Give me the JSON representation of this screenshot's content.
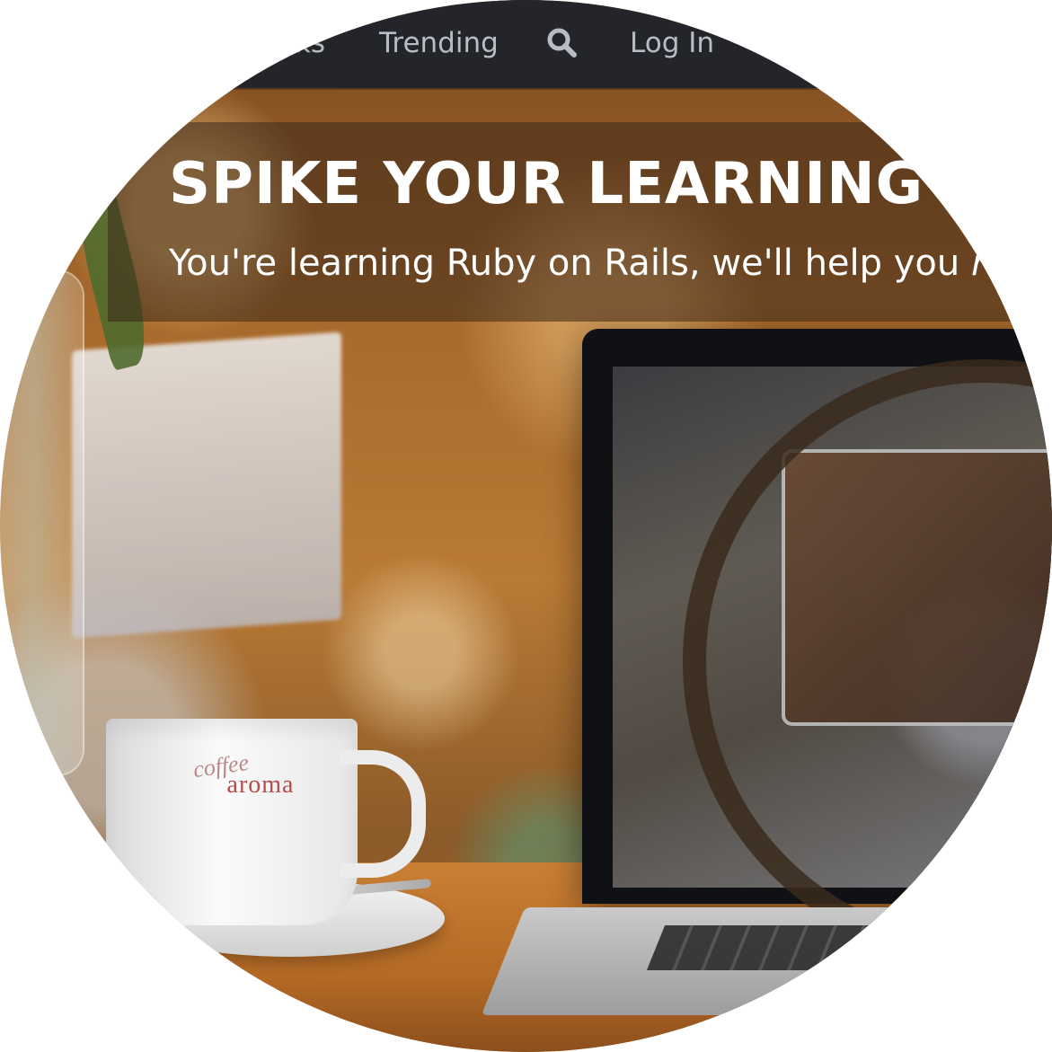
{
  "topnav": {
    "items": [
      {
        "label": "ks"
      },
      {
        "label": "Trending"
      },
      {
        "label": "Log In"
      }
    ],
    "search_icon": "search-icon",
    "background": "#23252a",
    "text_color": "#b9bcc2"
  },
  "hero": {
    "title": "SPIKE YOUR LEARNING",
    "subtitle_main": "You're learning Ruby on Rails, we'll help you ",
    "subtitle_emphasis": "re",
    "band_color": "rgba(60,40,25,0.55)"
  },
  "photo": {
    "cup_brand_script": "coffee",
    "cup_brand": "aroma"
  }
}
